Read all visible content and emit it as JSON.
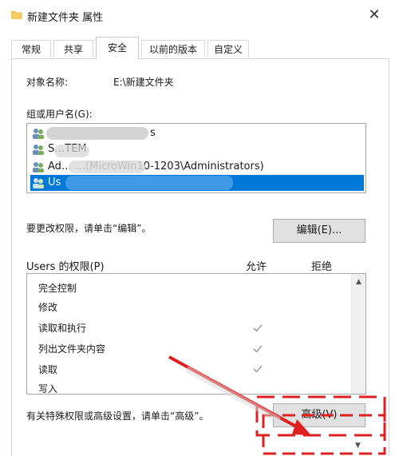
{
  "window": {
    "title": "新建文件夹 属性",
    "close_label": "✕"
  },
  "tabs": [
    {
      "label": "常规"
    },
    {
      "label": "共享"
    },
    {
      "label": "安全",
      "active": true
    },
    {
      "label": "以前的版本"
    },
    {
      "label": "自定义"
    }
  ],
  "security": {
    "object_name_label": "对象名称:",
    "object_name_value": "E:\\新建文件夹",
    "group_label": "组或用户名(G):",
    "users": [
      {
        "name": "s",
        "icon": "users-group-icon"
      },
      {
        "name": "S…TEM",
        "icon": "users-group-icon"
      },
      {
        "name": "Ad…            …(MicroWin10-1203\\Administrators)",
        "icon": "users-group-icon"
      },
      {
        "name": "Us",
        "icon": "users-group-icon",
        "selected": true
      }
    ],
    "change_hint": "要更改权限，请单击“编辑”。",
    "edit_button": "编辑(E)...",
    "permissions_title": "Users 的权限(P)",
    "allow_header": "允许",
    "deny_header": "拒绝",
    "permissions": [
      {
        "name": "完全控制",
        "allow": false
      },
      {
        "name": "修改",
        "allow": false
      },
      {
        "name": "读取和执行",
        "allow": true
      },
      {
        "name": "列出文件夹内容",
        "allow": true
      },
      {
        "name": "读取",
        "allow": true
      },
      {
        "name": "写入",
        "allow": false
      }
    ],
    "advanced_hint": "有关特殊权限或高级设置，请单击“高级”。",
    "advanced_button": "高级(V)"
  },
  "colors": {
    "selection": "#0078d7",
    "annotation": "#e02020",
    "check": "#a0a0a0"
  }
}
